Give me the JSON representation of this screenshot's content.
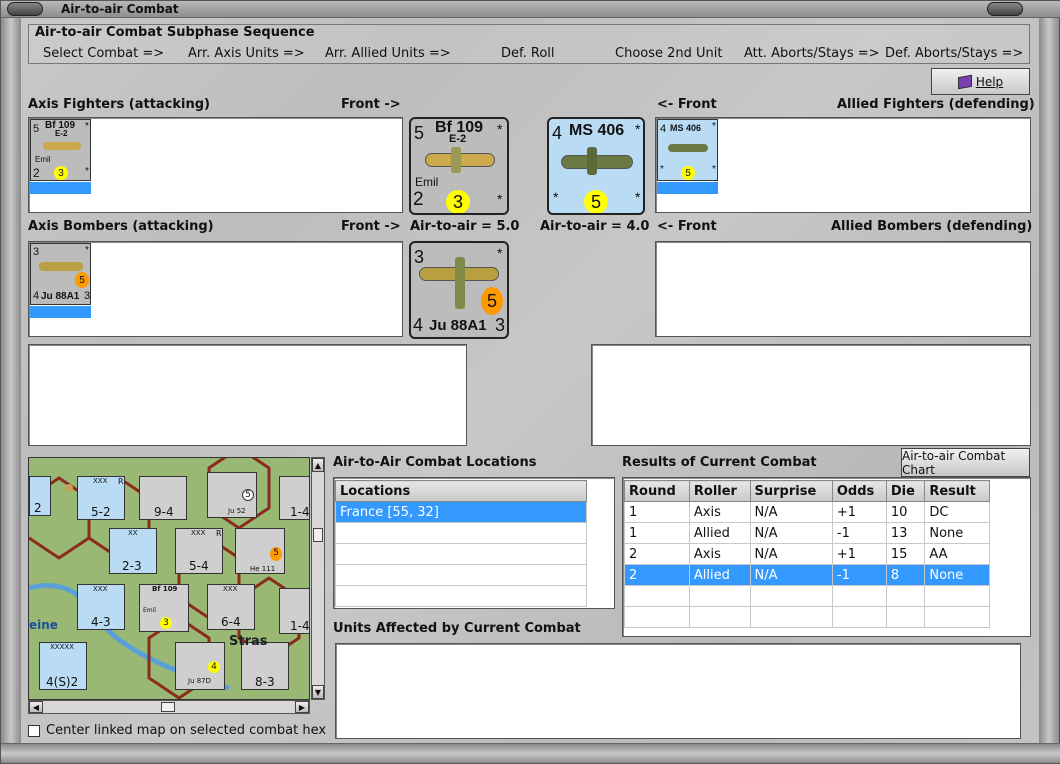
{
  "window": {
    "title": "Air-to-air Combat"
  },
  "sequence": {
    "title": "Air-to-air Combat Subphase Sequence",
    "steps": [
      "Select Combat =>",
      "Arr. Axis Units =>",
      "Arr. Allied Units =>",
      "Def. Roll",
      "Choose 2nd Unit",
      "Att. Aborts/Stays =>",
      "Def. Aborts/Stays =>"
    ]
  },
  "help": {
    "label": "Help"
  },
  "sections": {
    "axis_fighters": "Axis Fighters (attacking)",
    "front_right": "Front ->",
    "front_left": "<- Front",
    "allied_fighters": "Allied Fighters (defending)",
    "axis_bombers": "Axis Bombers (attacking)",
    "front_right_2": "Front ->",
    "air_to_air_axis": "Air-to-air = 5.0",
    "air_to_air_allied": "Air-to-air = 4.0",
    "front_left_2": "<- Front",
    "allied_bombers": "Allied Bombers (defending)"
  },
  "counters": {
    "bf109": {
      "name": "Bf 109",
      "variant": "E-2",
      "pilot": "Emil",
      "top_left": "5",
      "bottom_left": "2",
      "pip": "3",
      "star_top": "*",
      "star_bottom": "*"
    },
    "ms406": {
      "name": "MS 406",
      "top_left": "4",
      "pip": "5",
      "star_top": "*",
      "star_left": "*",
      "star_right": "*"
    },
    "ju88": {
      "name": "Ju 88A1",
      "top_left": "3",
      "bottom_left": "4",
      "bottom_right": "3",
      "pip": "5",
      "star_top": "*"
    }
  },
  "locations": {
    "title": "Air-to-Air Combat Locations",
    "header": "Locations",
    "items": [
      "France [55, 32]"
    ]
  },
  "results": {
    "title": "Results of Current Combat",
    "chart_button": "Air-to-air Combat Chart",
    "headers": [
      "Round",
      "Roller",
      "Surprise",
      "Odds",
      "Die",
      "Result"
    ],
    "rows": [
      [
        "1",
        "Axis",
        "N/A",
        "+1",
        "10",
        "DC"
      ],
      [
        "1",
        "Allied",
        "N/A",
        "-1",
        "13",
        "None"
      ],
      [
        "2",
        "Axis",
        "N/A",
        "+1",
        "15",
        "AA"
      ],
      [
        "2",
        "Allied",
        "N/A",
        "-1",
        "8",
        "None"
      ]
    ],
    "selected_row": 3
  },
  "affected": {
    "title": "Units Affected by Current Combat"
  },
  "map_option": {
    "label": "Center linked map on selected combat hex"
  },
  "map_counters": [
    {
      "label": "5-2",
      "top": "XXX",
      "side": "R"
    },
    {
      "label": "9-4",
      "top": "XXX"
    },
    {
      "label": "2-3",
      "top": "XX"
    },
    {
      "label": "5-4",
      "top": "XXX",
      "side": "R"
    },
    {
      "label": "4-3",
      "top": "XXX"
    },
    {
      "label": "6-4",
      "top": "XXX"
    },
    {
      "label": "4(S)2",
      "top": "XXXXX"
    },
    {
      "label": "8-3",
      "top": "XXX"
    },
    {
      "label": "1-4"
    },
    {
      "label": "1-4"
    }
  ],
  "map_air": [
    {
      "name": "Ju 52",
      "value": "5"
    },
    {
      "name": "He 111",
      "value": "5"
    },
    {
      "name": "Bf 109",
      "variant": "E-2",
      "pilot": "Emil",
      "value": "3"
    },
    {
      "name": "Ju 87D",
      "value": "4"
    }
  ],
  "map_text": {
    "place": "eine",
    "town": "Stras"
  },
  "colors": {
    "highlight": "#3399ff",
    "counter_grey": "#bcbcbc",
    "counter_blue": "#b9dbf4",
    "pip_yellow": "#ffff00",
    "pip_orange": "#ff9900"
  }
}
